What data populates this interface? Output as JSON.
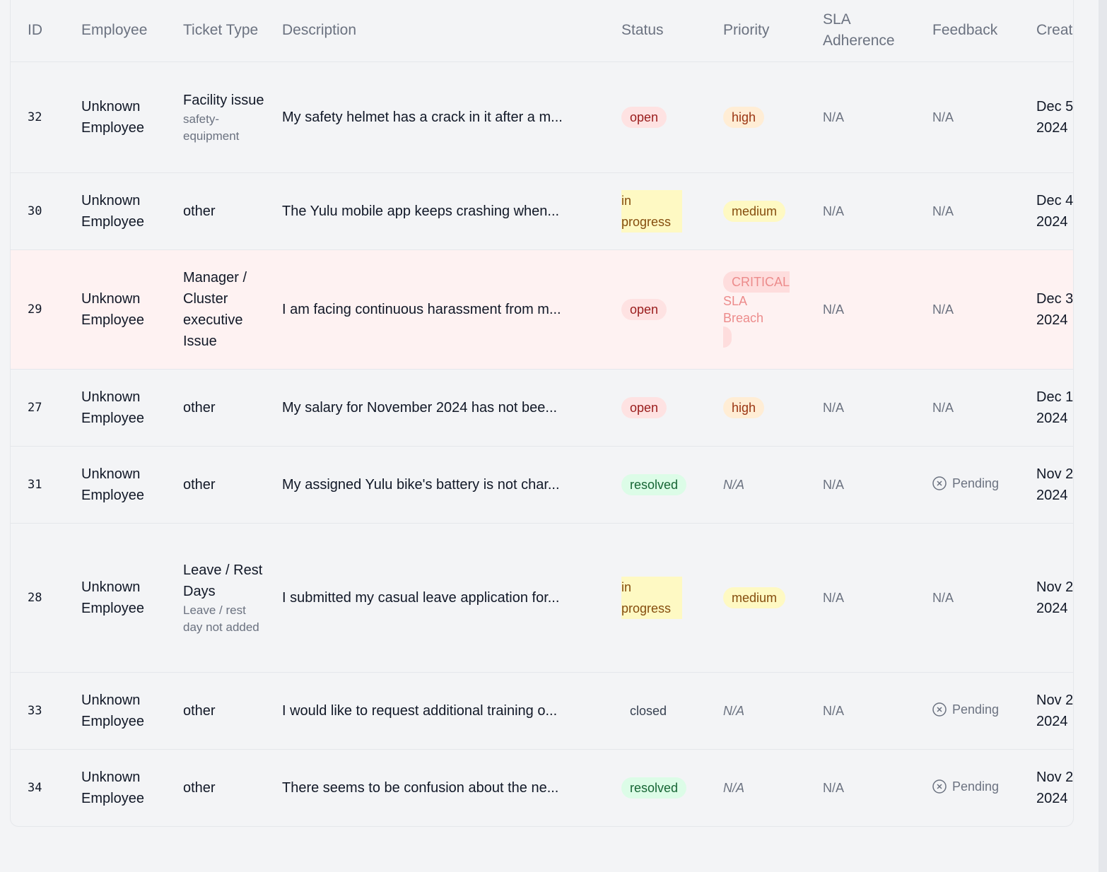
{
  "columns": {
    "id": "ID",
    "employee": "Employee",
    "ticket_type": "Ticket Type",
    "description": "Description",
    "status": "Status",
    "priority": "Priority",
    "sla": "SLA Adherence",
    "feedback": "Feedback",
    "created": "Create"
  },
  "rows": [
    {
      "id": "32",
      "employee": "Unknown Employee",
      "type": "Facility issue",
      "subtype": "safety-equipment",
      "description": "My safety helmet has a crack in it after a m...",
      "status": "open",
      "priority": "high",
      "sla": "N/A",
      "feedback": "N/A",
      "created": "Dec 5, 2024"
    },
    {
      "id": "30",
      "employee": "Unknown Employee",
      "type": "other",
      "subtype": "",
      "description": "The Yulu mobile app keeps crashing when...",
      "status": "in progress",
      "priority": "medium",
      "sla": "N/A",
      "feedback": "N/A",
      "created": "Dec 4 2024"
    },
    {
      "id": "29",
      "employee": "Unknown Employee",
      "type": "Manager / Cluster executive Issue",
      "subtype": "",
      "description": "I am facing continuous harassment from m...",
      "status": "open",
      "priority": "CRITICAL",
      "priority_note": "SLA Breach",
      "sla": "N/A",
      "feedback": "N/A",
      "created": "Dec 3 2024"
    },
    {
      "id": "27",
      "employee": "Unknown Employee",
      "type": "other",
      "subtype": "",
      "description": "My salary for November 2024 has not bee...",
      "status": "open",
      "priority": "high",
      "sla": "N/A",
      "feedback": "N/A",
      "created": "Dec 1, 2024"
    },
    {
      "id": "31",
      "employee": "Unknown Employee",
      "type": "other",
      "subtype": "",
      "description": "My assigned Yulu bike's battery is not char...",
      "status": "resolved",
      "priority": "N/A",
      "sla": "N/A",
      "feedback": "Pending",
      "created": "Nov 2 2024"
    },
    {
      "id": "28",
      "employee": "Unknown Employee",
      "type": "Leave / Rest Days",
      "subtype": "Leave / rest day not added",
      "description": "I submitted my casual leave application for...",
      "status": "in progress",
      "priority": "medium",
      "sla": "N/A",
      "feedback": "N/A",
      "created": "Nov 2 2024"
    },
    {
      "id": "33",
      "employee": "Unknown Employee",
      "type": "other",
      "subtype": "",
      "description": "I would like to request additional training o...",
      "status": "closed",
      "priority": "N/A",
      "sla": "N/A",
      "feedback": "Pending",
      "created": "Nov 2 2024"
    },
    {
      "id": "34",
      "employee": "Unknown Employee",
      "type": "other",
      "subtype": "",
      "description": "There seems to be confusion about the ne...",
      "status": "resolved",
      "priority": "N/A",
      "sla": "N/A",
      "feedback": "Pending",
      "created": "Nov 2 2024"
    }
  ],
  "colors": {
    "critical_row": "#fef2f2",
    "open": "#fee2e2",
    "in_progress": "#fef9c3",
    "resolved": "#dcfce7",
    "high": "#ffedd5"
  },
  "icons": {
    "pending": "x-circle-icon"
  }
}
